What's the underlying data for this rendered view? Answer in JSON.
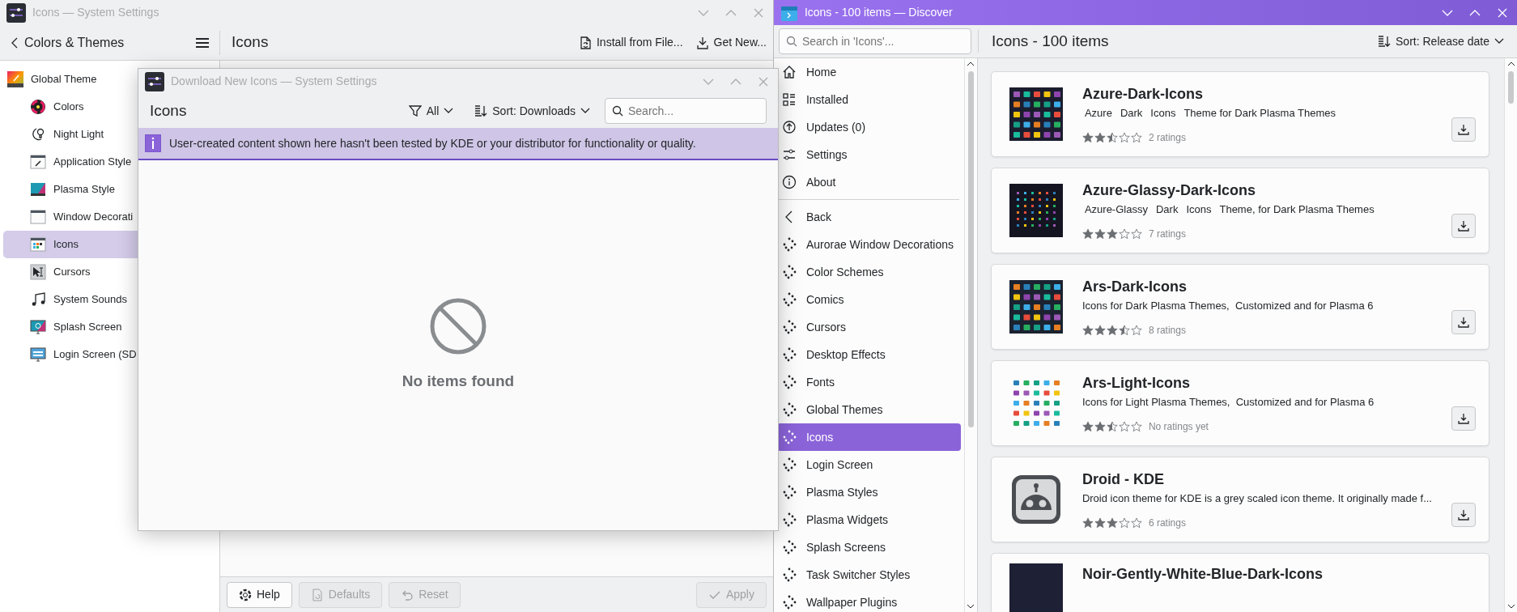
{
  "settings_window": {
    "title": "Icons — System Settings",
    "back_label": "Colors & Themes",
    "page_title": "Icons",
    "actions": [
      {
        "label": "Install from File..."
      },
      {
        "label": "Get New..."
      }
    ],
    "sidebar": [
      {
        "label": "Global Theme",
        "selected": false,
        "children": [
          {
            "label": "Colors",
            "selected": false
          },
          {
            "label": "Night Light",
            "selected": false
          },
          {
            "label": "Application Style",
            "selected": false
          },
          {
            "label": "Plasma Style",
            "selected": false
          },
          {
            "label": "Window Decorati",
            "selected": false
          },
          {
            "label": "Icons",
            "selected": true
          },
          {
            "label": "Cursors",
            "selected": false
          },
          {
            "label": "System Sounds",
            "selected": false
          },
          {
            "label": "Splash Screen",
            "selected": false
          },
          {
            "label": "Login Screen (SD",
            "selected": false
          }
        ]
      }
    ],
    "left_buttons": [
      {
        "label": "Help",
        "disabled": false
      },
      {
        "label": "Defaults",
        "disabled": true
      },
      {
        "label": "Reset",
        "disabled": true
      }
    ],
    "right_buttons": [
      {
        "label": "Apply",
        "disabled": true
      }
    ]
  },
  "download_dialog": {
    "title": "Download New Icons — System Settings",
    "heading": "Icons",
    "filter": "All",
    "sort": "Sort: Downloads",
    "search": {
      "placeholder": "Search..."
    },
    "banner": "User-created content shown here hasn't been tested by KDE or your distributor for functionality or quality.",
    "empty_message": "No items found"
  },
  "discover_window": {
    "title": "Icons - 100 items — Discover",
    "search": {
      "placeholder": "Search in 'Icons'..."
    },
    "heading": "Icons - 100 items",
    "sort": "Sort: Release date",
    "sidebar": [
      {
        "kind": "nav",
        "label": "Home",
        "selected": false
      },
      {
        "kind": "nav",
        "label": "Installed",
        "selected": false
      },
      {
        "kind": "nav",
        "label": "Updates (0)",
        "selected": false
      },
      {
        "kind": "nav",
        "label": "Settings",
        "selected": false
      },
      {
        "kind": "nav",
        "label": "About",
        "selected": false
      },
      {
        "kind": "back",
        "label": "Back",
        "selected": false
      },
      {
        "kind": "category",
        "label": "Aurorae Window Decorations",
        "selected": false
      },
      {
        "kind": "category",
        "label": "Color Schemes",
        "selected": false
      },
      {
        "kind": "category",
        "label": "Comics",
        "selected": false
      },
      {
        "kind": "category",
        "label": "Cursors",
        "selected": false
      },
      {
        "kind": "category",
        "label": "Desktop Effects",
        "selected": false
      },
      {
        "kind": "category",
        "label": "Fonts",
        "selected": false
      },
      {
        "kind": "category",
        "label": "Global Themes",
        "selected": false
      },
      {
        "kind": "category",
        "label": "Icons",
        "selected": true
      },
      {
        "kind": "category",
        "label": "Login Screen",
        "selected": false
      },
      {
        "kind": "category",
        "label": "Plasma Styles",
        "selected": false
      },
      {
        "kind": "category",
        "label": "Plasma Widgets",
        "selected": false
      },
      {
        "kind": "category",
        "label": "Splash Screens",
        "selected": false
      },
      {
        "kind": "category",
        "label": "Task Switcher Styles",
        "selected": false
      },
      {
        "kind": "category",
        "label": "Wallpaper Plugins",
        "selected": false
      }
    ],
    "items": [
      {
        "name": "Azure-Dark-Icons",
        "tags": [
          "Azure",
          "Dark",
          "Icons",
          "Theme for Dark Plasma Themes"
        ],
        "stars": 2.5,
        "ratings": "2 ratings"
      },
      {
        "name": "Azure-Glassy-Dark-Icons",
        "tags": [
          "Azure-Glassy",
          "Dark",
          "Icons",
          "Theme, for Dark Plasma Themes"
        ],
        "stars": 3,
        "ratings": "7 ratings"
      },
      {
        "name": "Ars-Dark-Icons",
        "description": "Icons for Dark Plasma Themes,  Customized and for Plasma 6",
        "stars": 3.5,
        "ratings": "8 ratings"
      },
      {
        "name": "Ars-Light-Icons",
        "description": "Icons for Light Plasma Themes,  Customized and for Plasma 6",
        "stars": 2.5,
        "ratings": "No ratings yet"
      },
      {
        "name": "Droid - KDE",
        "description": "Droid icon theme for KDE is a grey scaled icon theme. It originally made f...",
        "stars": 3,
        "ratings": "6 ratings"
      },
      {
        "name": "Noir-Gently-White-Blue-Dark-Icons"
      }
    ]
  }
}
